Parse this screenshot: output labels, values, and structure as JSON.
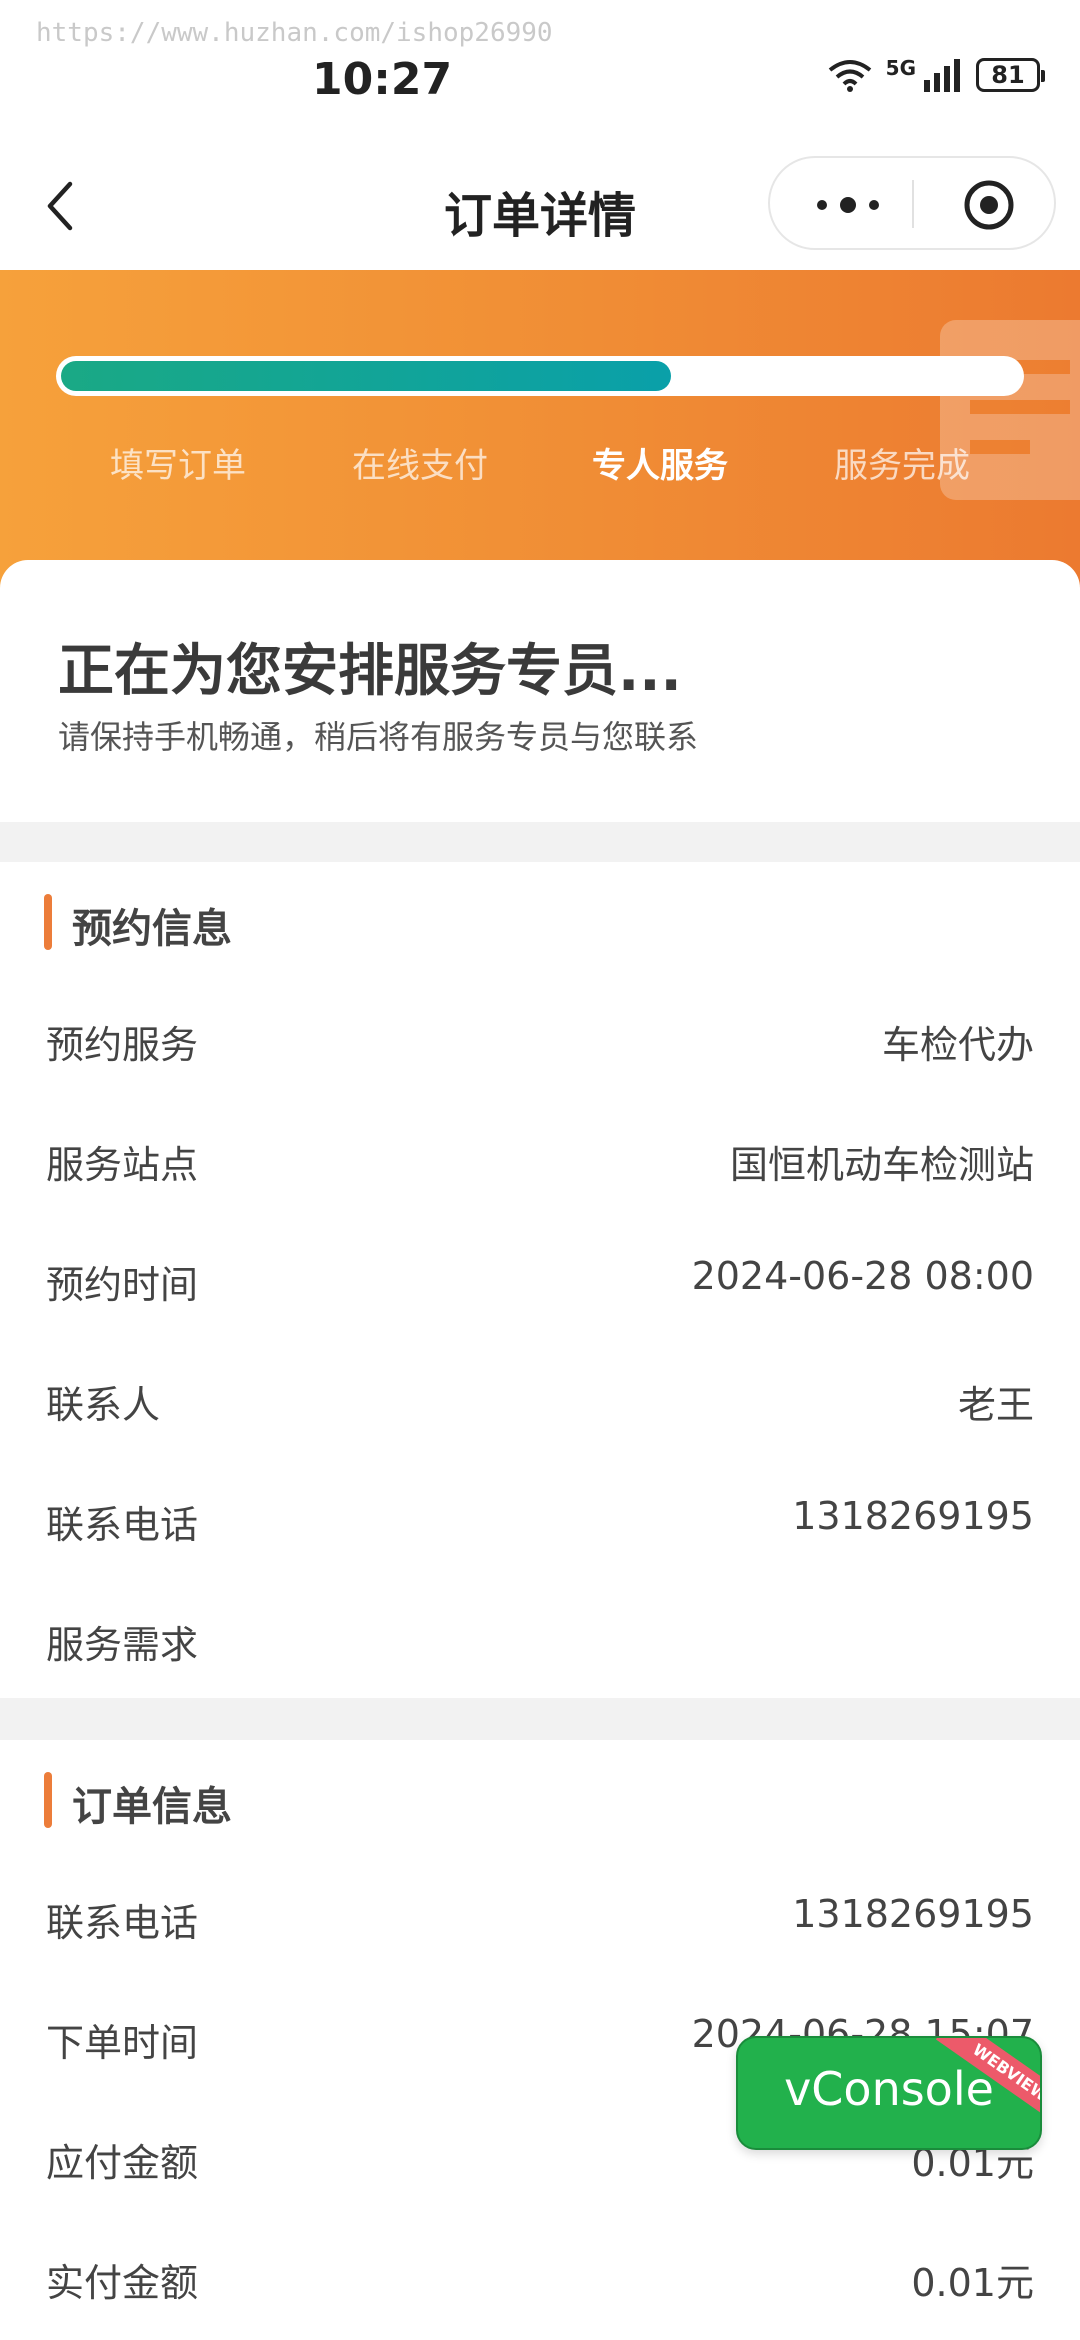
{
  "watermark": "https://www.huzhan.com/ishop26990",
  "status_bar": {
    "time": "10:27",
    "network": "5G",
    "battery": "81"
  },
  "nav": {
    "title": "订单详情"
  },
  "progress": {
    "percent": 64,
    "steps": [
      {
        "label": "填写订单",
        "active": false
      },
      {
        "label": "在线支付",
        "active": false
      },
      {
        "label": "专人服务",
        "active": true
      },
      {
        "label": "服务完成",
        "active": false
      }
    ]
  },
  "arrange": {
    "title": "正在为您安排服务专员...",
    "subtitle": "请保持手机畅通，稍后将有服务专员与您联系"
  },
  "appointment": {
    "title": "预约信息",
    "rows": [
      {
        "label": "预约服务",
        "value": "车检代办"
      },
      {
        "label": "服务站点",
        "value": "国恒机动车检测站"
      },
      {
        "label": "预约时间",
        "value": "2024-06-28 08:00"
      },
      {
        "label": "联系人",
        "value": "老王"
      },
      {
        "label": "联系电话",
        "value": "1318269195"
      },
      {
        "label": "服务需求",
        "value": ""
      }
    ]
  },
  "order": {
    "title": "订单信息",
    "rows": [
      {
        "label": "联系电话",
        "value": "1318269195"
      },
      {
        "label": "下单时间",
        "value": "2024-06-28 15:07"
      },
      {
        "label": "应付金额",
        "value": "0.01元"
      },
      {
        "label": "实付金额",
        "value": "0.01元"
      }
    ]
  },
  "vconsole": {
    "label": "vConsole",
    "tag": "WEBVIEW"
  },
  "colors": {
    "accent": "#ec7d3a",
    "progress": "#1aa985",
    "vconsole": "#22b14c"
  }
}
